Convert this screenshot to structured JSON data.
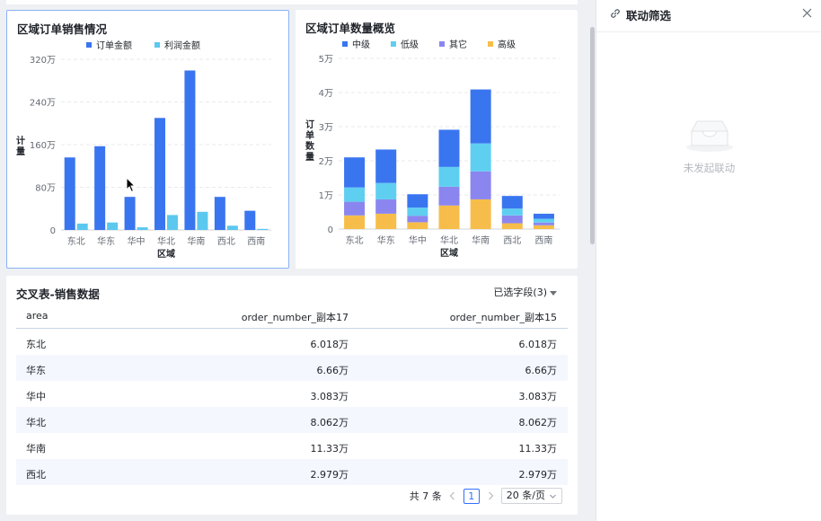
{
  "chart1": {
    "title": "区域订单销售情况",
    "chart_data": {
      "type": "bar",
      "categories": [
        "东北",
        "华东",
        "华中",
        "华北",
        "华南",
        "西北",
        "西南"
      ],
      "series": [
        {
          "name": "订单金额",
          "values": [
            1360000,
            1570000,
            620000,
            2100000,
            2990000,
            620000,
            360000
          ],
          "color": "#3a75f0"
        },
        {
          "name": "利润金额",
          "values": [
            120000,
            140000,
            50000,
            280000,
            340000,
            80000,
            20000
          ],
          "color": "#5bc8f0"
        }
      ],
      "xlabel": "区域",
      "ylabel": "计量",
      "ylim": [
        0,
        3200000
      ],
      "yticks": [
        0,
        800000,
        1600000,
        2400000,
        3200000
      ],
      "yticklabels": [
        "0",
        "80万",
        "160万",
        "240万",
        "320万"
      ],
      "legend": "top",
      "grid": true
    }
  },
  "chart2": {
    "title": "区域订单数量概览",
    "chart_data": {
      "type": "bar",
      "stacked": true,
      "categories": [
        "东北",
        "华东",
        "华中",
        "华北",
        "华南",
        "西北",
        "西南"
      ],
      "series": [
        {
          "name": "高级",
          "values": [
            4000,
            4500,
            2000,
            6900,
            8700,
            1700,
            1100
          ],
          "color": "#f7bd4a"
        },
        {
          "name": "其它",
          "values": [
            4000,
            4200,
            1900,
            5500,
            8200,
            2300,
            800
          ],
          "color": "#8b86ef"
        },
        {
          "name": "低级",
          "values": [
            4200,
            4800,
            2400,
            5800,
            8200,
            2000,
            1100
          ],
          "color": "#5ecff0"
        },
        {
          "name": "中级",
          "values": [
            8800,
            9800,
            3900,
            10900,
            15800,
            3700,
            1500
          ],
          "color": "#3a75f0"
        }
      ],
      "legend_order": [
        "中级",
        "低级",
        "其它",
        "高级"
      ],
      "xlabel": "区域",
      "ylabel": "订单数量",
      "ylim": [
        0,
        50000
      ],
      "yticks": [
        0,
        10000,
        20000,
        30000,
        40000,
        50000
      ],
      "yticklabels": [
        "0",
        "1万",
        "2万",
        "3万",
        "4万",
        "5万"
      ],
      "legend": "top",
      "grid": true
    }
  },
  "table": {
    "title": "交叉表-销售数据",
    "selector_label": "已选字段(3)",
    "columns": [
      "area",
      "order_number_副本17",
      "order_number_副本15"
    ],
    "rows": [
      [
        "东北",
        "6.018万",
        "6.018万"
      ],
      [
        "华东",
        "6.66万",
        "6.66万"
      ],
      [
        "华中",
        "3.083万",
        "3.083万"
      ],
      [
        "华北",
        "8.062万",
        "8.062万"
      ],
      [
        "华南",
        "11.33万",
        "11.33万"
      ],
      [
        "西北",
        "2.979万",
        "2.979万"
      ]
    ],
    "pager": {
      "total": "共 7 条",
      "current_page": "1",
      "page_size": "20 条/页"
    }
  },
  "side_panel": {
    "title": "联动筛选",
    "empty_text": "未发起联动"
  },
  "colors": {
    "accent": "#3370ff",
    "bar_blue": "#3a75f0",
    "bar_cyan": "#5bc8f0"
  },
  "icons": [
    "link-icon",
    "close-icon",
    "empty-inbox-icon",
    "chevron-left-icon",
    "chevron-right-icon",
    "chevron-down-icon",
    "caret-down-icon",
    "mouse-cursor-icon"
  ]
}
